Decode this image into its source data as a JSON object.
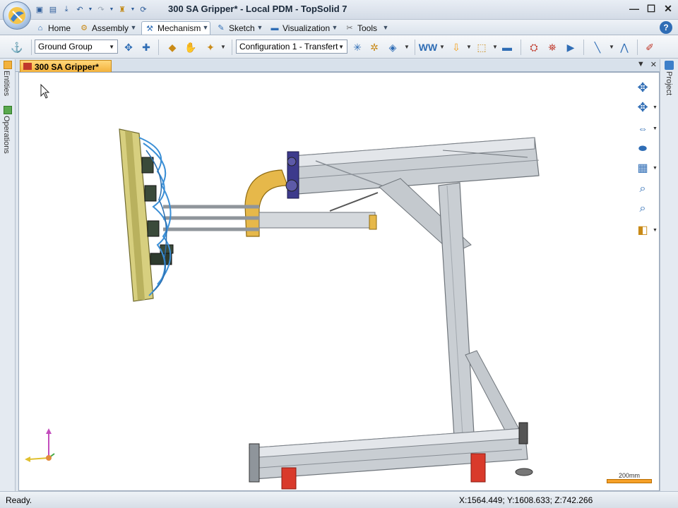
{
  "window": {
    "title": "300  SA Gripper* - Local PDM - TopSolid 7",
    "minimize": "—",
    "maximize": "☐",
    "close": "✕"
  },
  "ribbon": {
    "tabs": [
      {
        "label": "Home",
        "icon": "home-icon"
      },
      {
        "label": "Assembly",
        "icon": "assembly-icon"
      },
      {
        "label": "Mechanism",
        "icon": "mechanism-icon",
        "active": true
      },
      {
        "label": "Sketch",
        "icon": "sketch-icon"
      },
      {
        "label": "Visualization",
        "icon": "visualization-icon"
      },
      {
        "label": "Tools",
        "icon": "tools-icon"
      }
    ],
    "help": "?"
  },
  "toolbar": {
    "group_select": "Ground Group",
    "configuration_select": "Configuration 1 - Transfert"
  },
  "side_panels": {
    "left": [
      "Entities",
      "Operations"
    ],
    "right": [
      "Project"
    ]
  },
  "document": {
    "tab_label": "300  SA Gripper*"
  },
  "viewport": {
    "scale_label": "200mm",
    "colors": {
      "frame": "#c9ced3",
      "gripper_plate": "#d7cf7f",
      "bracket": "#e6b84a",
      "foot_red": "#d93a2b",
      "hoses": "#3b8fd6"
    }
  },
  "status": {
    "left": "Ready.",
    "coordinates": "X:1564.449; Y:1608.633; Z:742.266"
  },
  "colors": {
    "accent": "#f3b23c",
    "title_bar": "#dfe6ee"
  }
}
